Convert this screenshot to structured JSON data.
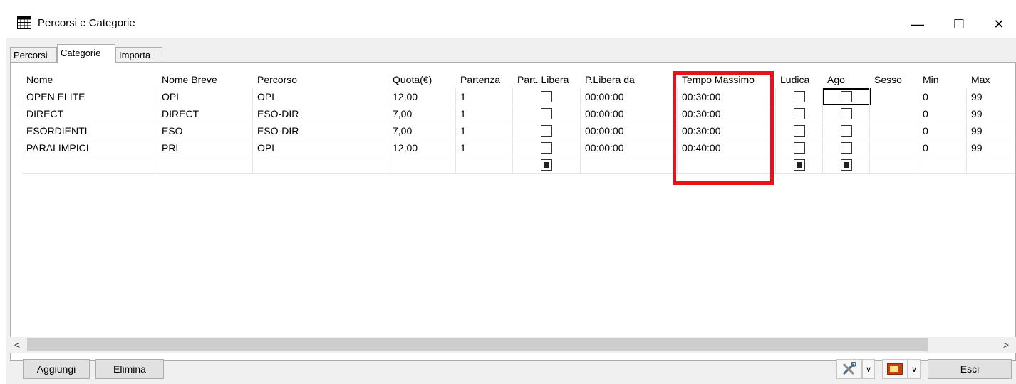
{
  "window": {
    "title": "Percorsi e Categorie",
    "icon": "table-icon",
    "controls": {
      "minimize": "—",
      "maximize": "☐",
      "close": "✕"
    }
  },
  "tabs": [
    {
      "label": "Percorsi",
      "active": false
    },
    {
      "label": "Categorie",
      "active": true
    },
    {
      "label": "Importa",
      "active": false
    }
  ],
  "grid": {
    "columns": [
      "Nome",
      "Nome Breve",
      "Percorso",
      "Quota(€)",
      "Partenza",
      "Part. Libera",
      "P.Libera da",
      "Tempo Massimo",
      "Ludica",
      "Ago",
      "Sesso",
      "Min",
      "Max"
    ],
    "rows": [
      {
        "nome": "OPEN ELITE",
        "nome_breve": "OPL",
        "percorso": "OPL",
        "quota": "12,00",
        "partenza": "1",
        "part_libera": false,
        "p_libera_da": "00:00:00",
        "tempo_massimo": "00:30:00",
        "ludica": false,
        "ago": false,
        "sesso": "",
        "min": "0",
        "max": "99"
      },
      {
        "nome": "DIRECT",
        "nome_breve": "DIRECT",
        "percorso": "ESO-DIR",
        "quota": "7,00",
        "partenza": "1",
        "part_libera": false,
        "p_libera_da": "00:00:00",
        "tempo_massimo": "00:30:00",
        "ludica": false,
        "ago": false,
        "sesso": "",
        "min": "0",
        "max": "99"
      },
      {
        "nome": "ESORDIENTI",
        "nome_breve": "ESO",
        "percorso": "ESO-DIR",
        "quota": "7,00",
        "partenza": "1",
        "part_libera": false,
        "p_libera_da": "00:00:00",
        "tempo_massimo": "00:30:00",
        "ludica": false,
        "ago": false,
        "sesso": "",
        "min": "0",
        "max": "99"
      },
      {
        "nome": "PARALIMPICI",
        "nome_breve": "PRL",
        "percorso": "OPL",
        "quota": "12,00",
        "partenza": "1",
        "part_libera": false,
        "p_libera_da": "00:00:00",
        "tempo_massimo": "00:40:00",
        "ludica": false,
        "ago": false,
        "sesso": "",
        "min": "0",
        "max": "99"
      }
    ],
    "new_row": {
      "part_libera": "indeterminate",
      "ludica": "indeterminate",
      "ago": "indeterminate"
    }
  },
  "highlight": {
    "column": "Tempo Massimo",
    "color": "#e8121a"
  },
  "scrollbar": {
    "left_arrow": "<",
    "right_arrow": ">"
  },
  "buttons": {
    "aggiungi": "Aggiungi",
    "elimina": "Elimina",
    "esci": "Esci",
    "tool_icon": "tools-icon",
    "flag_icon": "flag-icon",
    "dropdown_arrow": "∨"
  }
}
